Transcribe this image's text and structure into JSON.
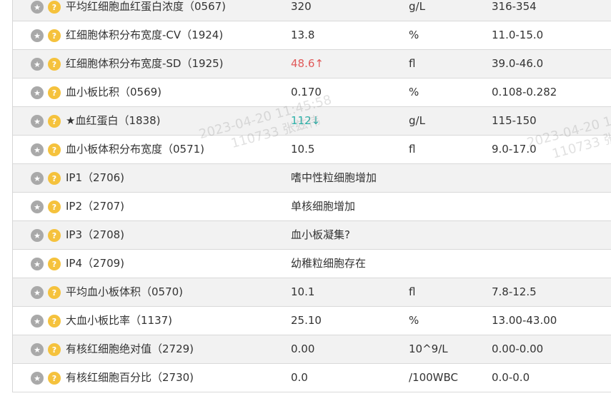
{
  "rows": [
    {
      "name": "平均红细胞血红蛋白浓度（0567)",
      "value": "320",
      "flag": "",
      "unit": "g/L",
      "range": "316-354"
    },
    {
      "name": "红细胞体积分布宽度-CV（1924)",
      "value": "13.8",
      "flag": "",
      "unit": "%",
      "range": "11.0-15.0"
    },
    {
      "name": "红细胞体积分布宽度-SD（1925)",
      "value": "48.6↑",
      "flag": "high",
      "unit": "fl",
      "range": "39.0-46.0"
    },
    {
      "name": "血小板比积（0569)",
      "value": "0.170",
      "flag": "",
      "unit": "%",
      "range": "0.108-0.282"
    },
    {
      "name": "★血红蛋白（1838)",
      "value": "112↓",
      "flag": "low",
      "unit": "g/L",
      "range": "115-150"
    },
    {
      "name": "血小板体积分布宽度（0571)",
      "value": "10.5",
      "flag": "",
      "unit": "fl",
      "range": "9.0-17.0"
    },
    {
      "name": "IP1（2706)",
      "value": "嗜中性粒细胞增加",
      "flag": "",
      "unit": "",
      "range": ""
    },
    {
      "name": "IP2（2707)",
      "value": "单核细胞增加",
      "flag": "",
      "unit": "",
      "range": ""
    },
    {
      "name": "IP3（2708)",
      "value": "血小板凝集?",
      "flag": "",
      "unit": "",
      "range": ""
    },
    {
      "name": "IP4（2709)",
      "value": "幼稚粒细胞存在",
      "flag": "",
      "unit": "",
      "range": ""
    },
    {
      "name": "平均血小板体积（0570)",
      "value": "10.1",
      "flag": "",
      "unit": "fl",
      "range": "7.8-12.5"
    },
    {
      "name": "大血小板比率（1137)",
      "value": "25.10",
      "flag": "",
      "unit": "%",
      "range": "13.00-43.00"
    },
    {
      "name": "有核红细胞绝对值（2729)",
      "value": "0.00",
      "flag": "",
      "unit": "10^9/L",
      "range": "0.00-0.00"
    },
    {
      "name": "有核红细胞百分比（2730)",
      "value": "0.0",
      "flag": "",
      "unit": "/100WBC",
      "range": "0.0-0.0"
    }
  ],
  "icons": {
    "star": "star-icon",
    "help": "help-icon"
  },
  "watermark": {
    "line1_center": "2023-04-20 11:45:58",
    "line2_center": "110733 张兹伟",
    "line1_right": "2023-04-20 1",
    "line2_right": "110733 张"
  },
  "colors": {
    "high": "#e05a5a",
    "low": "#2ab0a8",
    "help_icon": "#f5c23d",
    "star_icon": "#a9a9a9"
  }
}
